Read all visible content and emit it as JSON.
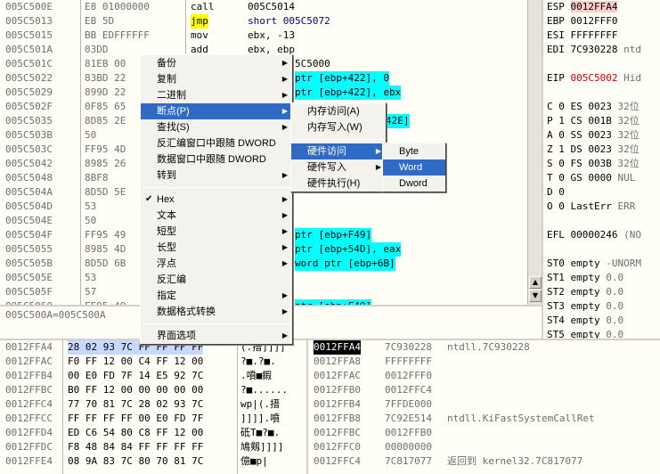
{
  "cpu": {
    "rows": [
      {
        "addr": "005C500E",
        "hex": "E8 01000000",
        "asm": "call",
        "op": "005C5014",
        "asm_hl": "",
        "op_hl": ""
      },
      {
        "addr": "005C5013",
        "hex": "EB 5D",
        "asm": "jmp",
        "op": "short 005C5072",
        "asm_hl": "yellow",
        "op_hl": ""
      },
      {
        "addr": "005C5015",
        "hex": "BB EDFFFFFF",
        "asm": "mov",
        "op": "ebx, -13",
        "asm_hl": "",
        "op_hl": ""
      },
      {
        "addr": "005C501A",
        "hex": "03DD",
        "asm": "add",
        "op": "ebx, ebp",
        "asm_hl": "",
        "op_hl": ""
      },
      {
        "addr": "005C501C",
        "hex": "81EB 00",
        "asm": "",
        "op": "5C5000",
        "asm_hl": "",
        "op_hl": ""
      },
      {
        "addr": "005C5022",
        "hex": "83BD 22",
        "asm": "",
        "op": "ptr [ebp+422], 0",
        "asm_hl": "",
        "op_hl": "cyan"
      },
      {
        "addr": "005C5029",
        "hex": "899D 22",
        "asm": "",
        "op": "ptr [ebp+422], ebx",
        "asm_hl": "",
        "op_hl": "cyan"
      },
      {
        "addr": "005C502F",
        "hex": "0F85 65",
        "asm": "",
        "op": "",
        "asm_hl": "",
        "op_hl": ""
      },
      {
        "addr": "005C5035",
        "hex": "8D85 2E",
        "asm": "",
        "op": "42E]",
        "asm_hl": "",
        "op_hl": "cyan"
      },
      {
        "addr": "005C503B",
        "hex": "50",
        "asm": "",
        "op": "",
        "asm_hl": "",
        "op_hl": ""
      },
      {
        "addr": "005C503C",
        "hex": "FF95 4D",
        "asm": "",
        "op": "",
        "asm_hl": "",
        "op_hl": ""
      },
      {
        "addr": "005C5042",
        "hex": "8985 26",
        "asm": "",
        "op": "",
        "asm_hl": "",
        "op_hl": ""
      },
      {
        "addr": "005C5048",
        "hex": "8BF8",
        "asm": "",
        "op": "",
        "asm_hl": "",
        "op_hl": ""
      },
      {
        "addr": "005C504A",
        "hex": "8D5D 5E",
        "asm": "",
        "op": "",
        "asm_hl": "",
        "op_hl": ""
      },
      {
        "addr": "005C504D",
        "hex": "53",
        "asm": "",
        "op": "",
        "asm_hl": "",
        "op_hl": ""
      },
      {
        "addr": "005C504E",
        "hex": "50",
        "asm": "",
        "op": "",
        "asm_hl": "",
        "op_hl": ""
      },
      {
        "addr": "005C504F",
        "hex": "FF95 49",
        "asm": "",
        "op": "ptr [ebp+F49]",
        "asm_hl": "",
        "op_hl": "cyan"
      },
      {
        "addr": "005C5055",
        "hex": "8985 4D",
        "asm": "",
        "op": "ptr [ebp+54D], eax",
        "asm_hl": "",
        "op_hl": "cyan"
      },
      {
        "addr": "005C505B",
        "hex": "8D5D 6B",
        "asm": "",
        "op": "word ptr [ebp+6B]",
        "asm_hl": "",
        "op_hl": "cyan"
      },
      {
        "addr": "005C505E",
        "hex": "53",
        "asm": "",
        "op": "",
        "asm_hl": "",
        "op_hl": ""
      },
      {
        "addr": "005C505F",
        "hex": "57",
        "asm": "",
        "op": "",
        "asm_hl": "",
        "op_hl": ""
      },
      {
        "addr": "005C5060",
        "hex": "FF95 49",
        "asm": "",
        "op": "ptr [ebp+F49]",
        "asm_hl": "",
        "op_hl": "cyan"
      }
    ]
  },
  "info_text": "005C500A=005C500A",
  "registers": {
    "rows": [
      {
        "name": "ESP",
        "val": "0012FFA4",
        "extra": "",
        "hl": true,
        "red": false
      },
      {
        "name": "EBP",
        "val": "0012FFF0",
        "extra": "",
        "hl": false,
        "red": false
      },
      {
        "name": "ESI",
        "val": "FFFFFFFF",
        "extra": "",
        "hl": false,
        "red": false
      },
      {
        "name": "EDI",
        "val": "7C930228",
        "extra": "ntd",
        "hl": false,
        "red": false
      },
      {
        "name": "",
        "val": "",
        "extra": "",
        "hl": false,
        "red": false
      },
      {
        "name": "EIP",
        "val": "005C5002",
        "extra": "Hid",
        "hl": false,
        "red": true
      },
      {
        "name": "",
        "val": "",
        "extra": "",
        "hl": false,
        "red": false
      },
      {
        "name": "C 0",
        "val": "ES 0023",
        "extra": "32位",
        "hl": false,
        "red": false
      },
      {
        "name": "P 1",
        "val": "CS 001B",
        "extra": "32位",
        "hl": false,
        "red": false
      },
      {
        "name": "A 0",
        "val": "SS 0023",
        "extra": "32位",
        "hl": false,
        "red": false
      },
      {
        "name": "Z 1",
        "val": "DS 0023",
        "extra": "32位",
        "hl": false,
        "red": false
      },
      {
        "name": "S 0",
        "val": "FS 003B",
        "extra": "32位",
        "hl": false,
        "red": false
      },
      {
        "name": "T 0",
        "val": "GS 0000",
        "extra": "NUL",
        "hl": false,
        "red": false
      },
      {
        "name": "D 0",
        "val": "",
        "extra": "",
        "hl": false,
        "red": false
      },
      {
        "name": "O 0",
        "val": "LastErr",
        "extra": "ERR",
        "hl": false,
        "red": false
      },
      {
        "name": "",
        "val": "",
        "extra": "",
        "hl": false,
        "red": false
      },
      {
        "name": "EFL",
        "val": "00000246",
        "extra": "(NO",
        "hl": false,
        "red": false
      },
      {
        "name": "",
        "val": "",
        "extra": "",
        "hl": false,
        "red": false
      },
      {
        "name": "ST0",
        "val": "empty",
        "extra": "-UNORM",
        "hl": false,
        "red": false
      },
      {
        "name": "ST1",
        "val": "empty",
        "extra": "0.0",
        "hl": false,
        "red": false
      },
      {
        "name": "ST2",
        "val": "empty",
        "extra": "0.0",
        "hl": false,
        "red": false
      },
      {
        "name": "ST3",
        "val": "empty",
        "extra": "0.0",
        "hl": false,
        "red": false
      },
      {
        "name": "ST4",
        "val": "empty",
        "extra": "0.0",
        "hl": false,
        "red": false
      },
      {
        "name": "ST5",
        "val": "empty",
        "extra": "0.0",
        "hl": false,
        "red": false
      },
      {
        "name": "ST6",
        "val": "empty",
        "extra": "1.0000",
        "hl": false,
        "red": false
      },
      {
        "name": "ST7",
        "val": "empty",
        "extra": "1.0000",
        "hl": false,
        "red": false
      }
    ]
  },
  "dump": {
    "rows": [
      {
        "addr": "0012FFA4",
        "hex": "28 02 93 7C FF FF FF FF",
        "ascii": "(.搢]]]]",
        "sel": true
      },
      {
        "addr": "0012FFAC",
        "hex": "F0 FF 12 00 C4 FF 12 00",
        "ascii": "?■.?■.",
        "sel": false
      },
      {
        "addr": "0012FFB4",
        "hex": "00 E0 FD 7F 14 E5 92 7C",
        "ascii": ".噴■鍜",
        "sel": false
      },
      {
        "addr": "0012FFBC",
        "hex": "B0 FF 12 00 00 00 00 00",
        "ascii": "?■......",
        "sel": false
      },
      {
        "addr": "0012FFC4",
        "hex": "77 70 81 7C 28 02 93 7C",
        "ascii": "wp|(.搢",
        "sel": false
      },
      {
        "addr": "0012FFCC",
        "hex": "FF FF FF FF 00 E0 FD 7F",
        "ascii": "]]]].噴",
        "sel": false
      },
      {
        "addr": "0012FFD4",
        "hex": "ED C6 54 80 C8 FF 12 00",
        "ascii": "砥T■?■.",
        "sel": false
      },
      {
        "addr": "0012FFDC",
        "hex": "F8 48 84 84 FF FF FF FF",
        "ascii": "鳩剱]]]]",
        "sel": false
      },
      {
        "addr": "0012FFE4",
        "hex": "08 9A 83 7C 80 70 81 7C",
        "ascii": "億■p|",
        "sel": false
      }
    ]
  },
  "stack": {
    "rows": [
      {
        "addr": "0012FFA4",
        "val": "7C930228",
        "cmt": "ntdll.7C930228",
        "sel": true
      },
      {
        "addr": "0012FFA8",
        "val": "FFFFFFFF",
        "cmt": "",
        "sel": false
      },
      {
        "addr": "0012FFAC",
        "val": "0012FFF0",
        "cmt": "",
        "sel": false
      },
      {
        "addr": "0012FFB0",
        "val": "0012FFC4",
        "cmt": "",
        "sel": false
      },
      {
        "addr": "0012FFB4",
        "val": "7FFDE000",
        "cmt": "",
        "sel": false
      },
      {
        "addr": "0012FFB8",
        "val": "7C92E514",
        "cmt": "ntdll.KiFastSystemCallRet",
        "sel": false
      },
      {
        "addr": "0012FFBC",
        "val": "0012FFB0",
        "cmt": "",
        "sel": false
      },
      {
        "addr": "0012FFC0",
        "val": "00000000",
        "cmt": "",
        "sel": false
      },
      {
        "addr": "0012FFC4",
        "val": "7C817077",
        "cmt": "返回到 kernel32.7C817077",
        "sel": false
      }
    ]
  },
  "menu_main": {
    "items": [
      {
        "label": "备份",
        "arrow": true,
        "check": false,
        "sel": false,
        "sep_after": false
      },
      {
        "label": "复制",
        "arrow": true,
        "check": false,
        "sel": false,
        "sep_after": false
      },
      {
        "label": "二进制",
        "arrow": true,
        "check": false,
        "sel": false,
        "sep_after": false
      },
      {
        "label": "断点(P)",
        "arrow": true,
        "check": false,
        "sel": true,
        "sep_after": false
      },
      {
        "label": "查找(S)",
        "arrow": true,
        "check": false,
        "sel": false,
        "sep_after": false
      },
      {
        "label": "反汇编窗口中跟随 DWORD",
        "arrow": false,
        "check": false,
        "sel": false,
        "sep_after": false
      },
      {
        "label": "数据窗口中跟随 DWORD",
        "arrow": false,
        "check": false,
        "sel": false,
        "sep_after": false
      },
      {
        "label": "转到",
        "arrow": true,
        "check": false,
        "sel": false,
        "sep_after": true
      },
      {
        "label": "Hex",
        "arrow": true,
        "check": true,
        "sel": false,
        "sep_after": false
      },
      {
        "label": "文本",
        "arrow": true,
        "check": false,
        "sel": false,
        "sep_after": false
      },
      {
        "label": "短型",
        "arrow": true,
        "check": false,
        "sel": false,
        "sep_after": false
      },
      {
        "label": "长型",
        "arrow": true,
        "check": false,
        "sel": false,
        "sep_after": false
      },
      {
        "label": "浮点",
        "arrow": true,
        "check": false,
        "sel": false,
        "sep_after": false
      },
      {
        "label": "反汇编",
        "arrow": false,
        "check": false,
        "sel": false,
        "sep_after": false
      },
      {
        "label": "指定",
        "arrow": true,
        "check": false,
        "sel": false,
        "sep_after": false
      },
      {
        "label": "数据格式转换",
        "arrow": true,
        "check": false,
        "sel": false,
        "sep_after": true
      },
      {
        "label": "界面选项",
        "arrow": true,
        "check": false,
        "sel": false,
        "sep_after": false
      }
    ]
  },
  "menu_breakpoint": {
    "items": [
      {
        "label": "内存访问(A)",
        "arrow": false,
        "sel": false,
        "sep_after": false
      },
      {
        "label": "内存写入(W)",
        "arrow": false,
        "sel": false,
        "sep_after": true
      },
      {
        "label": "硬件访问",
        "arrow": true,
        "sel": true,
        "sep_after": false
      },
      {
        "label": "硬件写入",
        "arrow": true,
        "sel": false,
        "sep_after": false
      },
      {
        "label": "硬件执行(H)",
        "arrow": false,
        "sel": false,
        "sep_after": false
      }
    ]
  },
  "menu_hw": {
    "items": [
      {
        "label": "Byte",
        "sel": false
      },
      {
        "label": "Word",
        "sel": true
      },
      {
        "label": "Dword",
        "sel": false
      }
    ]
  },
  "icons": {
    "submenu_arrow": "▶",
    "check": "✔",
    "scroll_up": "▲",
    "scroll_down": "▼"
  },
  "colors": {
    "selection": "#316ac5",
    "highlight_yellow": "#ffff00",
    "highlight_cyan": "#00ffff",
    "eip_red": "#d40000"
  }
}
